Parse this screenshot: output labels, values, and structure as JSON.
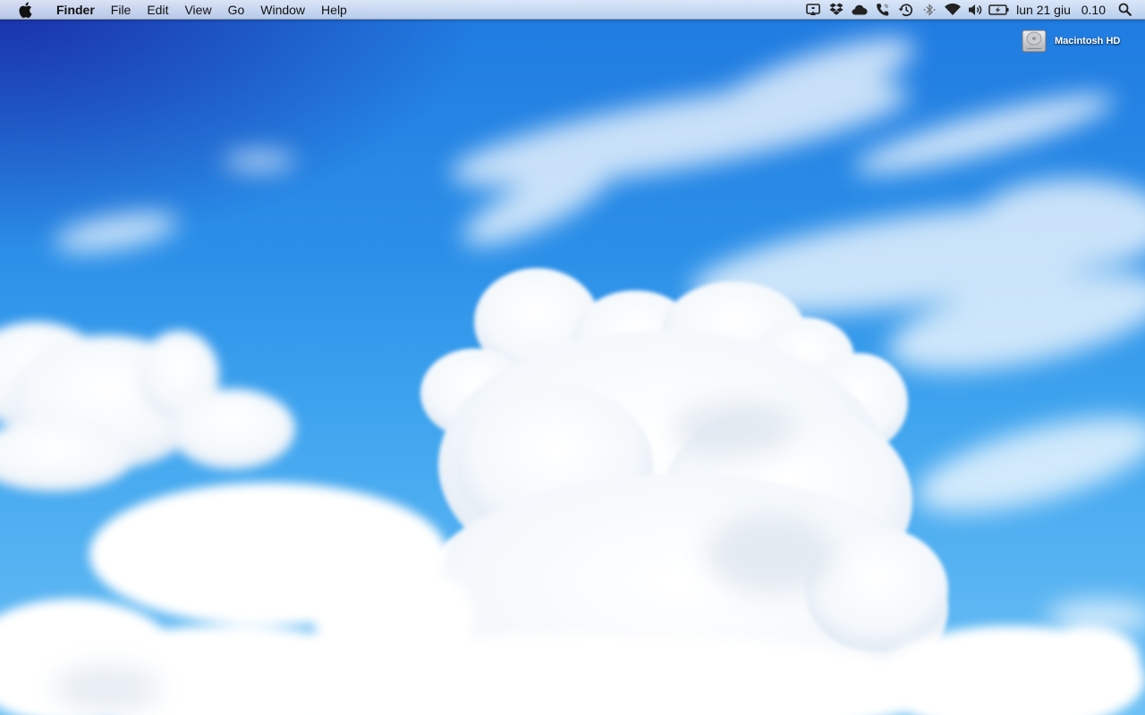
{
  "menubar": {
    "apple_icon": "apple-logo-icon",
    "app_name": "Finder",
    "menus": [
      "File",
      "Edit",
      "View",
      "Go",
      "Window",
      "Help"
    ],
    "status_icons": [
      "airplay-icon",
      "dropbox-icon",
      "cloud-icon",
      "phone-icon",
      "time-machine-icon",
      "bluetooth-icon",
      "wifi-icon",
      "volume-icon",
      "battery-icon"
    ],
    "clock_date": "lun 21 giu",
    "clock_time": "0.10",
    "spotlight_icon": "spotlight-search-icon"
  },
  "desktop": {
    "items": [
      {
        "label": "Macintosh HD",
        "icon": "hard-drive-icon"
      }
    ]
  },
  "colors": {
    "sky_top": "#1a2fa8",
    "sky_mid": "#2b8fe8",
    "sky_bottom": "#6cc0f5",
    "cloud": "#ffffff"
  }
}
